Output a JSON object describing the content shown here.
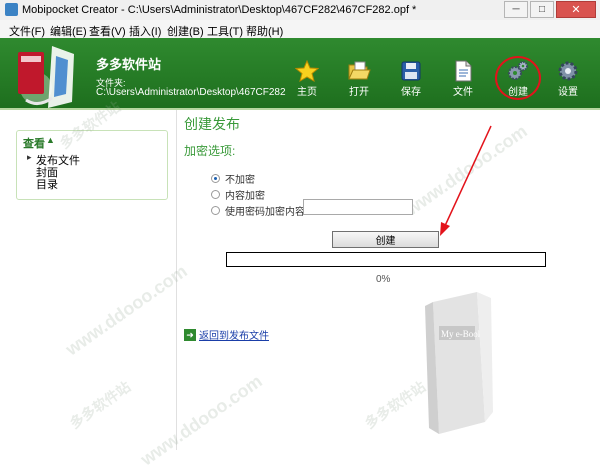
{
  "window": {
    "title": "Mobipocket Creator - C:\\Users\\Administrator\\Desktop\\467CF282\\467CF282.opf *",
    "minimize": "─",
    "maximize": "□",
    "close": "✕"
  },
  "menu": [
    "文件(F)",
    "编辑(E)",
    "查看(V)",
    "插入(I)",
    "创建(B)",
    "工具(T)",
    "帮助(H)"
  ],
  "header": {
    "brand": "多多软件站",
    "file_label": "文件夹:",
    "file_path": "C:\\Users\\Administrator\\Desktop\\467CF282"
  },
  "toolbar": [
    {
      "label": "主页",
      "icon": "star-icon"
    },
    {
      "label": "打开",
      "icon": "folder-open-icon"
    },
    {
      "label": "保存",
      "icon": "floppy-disk-icon"
    },
    {
      "label": "文件",
      "icon": "document-icon"
    },
    {
      "label": "创建",
      "icon": "gears-icon"
    },
    {
      "label": "设置",
      "icon": "gear-icon"
    }
  ],
  "nav": {
    "title": "查看",
    "caret": "▲",
    "items": [
      "发布文件",
      "封面",
      "目录"
    ]
  },
  "main": {
    "title": "创建发布",
    "section": "加密选项:",
    "options": [
      "不加密",
      "内容加密",
      "使用密码加密内容:"
    ],
    "selected_option": "不加密",
    "password_value": "",
    "create_label": "创建",
    "progress_percent": 0,
    "progress_text": "0%",
    "back_label": "返回到发布文件"
  },
  "watermark": [
    "多多软件站",
    "www.ddooo.com"
  ],
  "colors": {
    "header_green": "#2f8a2f",
    "accent_green": "#3a9a3a",
    "highlight_red": "#e3131b",
    "link_blue": "#1a3ea8"
  }
}
